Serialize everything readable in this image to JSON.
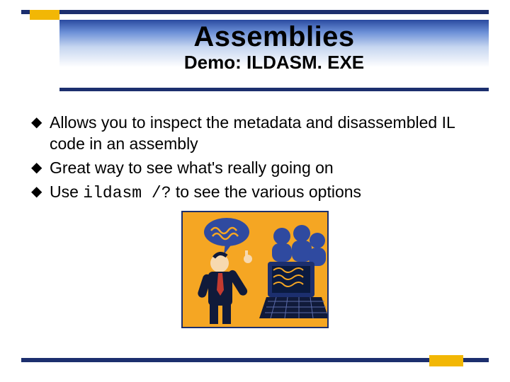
{
  "header": {
    "title": "Assemblies",
    "subtitle": "Demo: ILDASM. EXE"
  },
  "bullets": [
    {
      "text": "Allows you to inspect the metadata and disassembled IL code in an assembly"
    },
    {
      "text": "Great way to see what's really going on"
    },
    {
      "prefix": "Use ",
      "code": "ildasm /?",
      "suffix": " to see the various options"
    }
  ],
  "glyph": "◆",
  "colors": {
    "rule": "#1c2f6e",
    "accent": "#f2b705",
    "illo_bg": "#f5a623"
  },
  "illustration": {
    "alt": "presenter-clipart"
  }
}
